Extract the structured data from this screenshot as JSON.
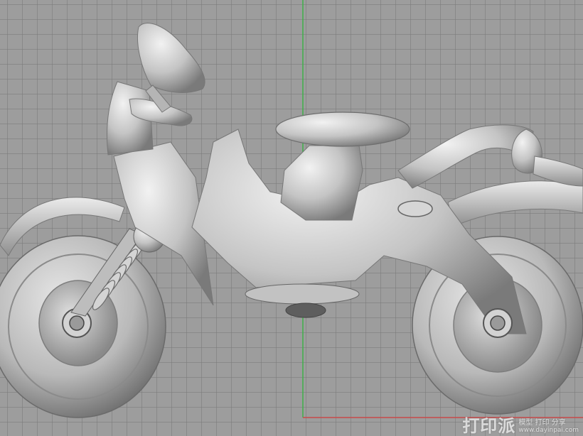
{
  "viewport": {
    "background_color": "#9d9d9d",
    "grid_color": "#787878",
    "axis_x_color": "#c84a4a",
    "axis_y_color": "#3fb04a",
    "model_color": "#c9c9c9",
    "model_shadow_color": "#6e6e6e"
  },
  "model": {
    "subject": "motorcycle"
  },
  "watermark": {
    "logo": "打印派",
    "tagline": "模型 打印 分享",
    "url": "www.dayinpai.com"
  }
}
